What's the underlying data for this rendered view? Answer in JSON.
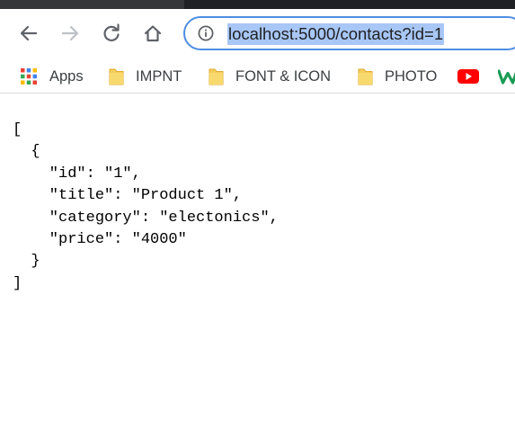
{
  "browser": {
    "address_bar": {
      "url": "localhost:5000/contacts?id=1",
      "selected": true
    },
    "icons": {
      "back": "back-arrow-icon",
      "forward": "forward-arrow-icon",
      "reload": "reload-icon",
      "home": "home-icon",
      "site_info": "info-circle-icon"
    },
    "bookmarks": [
      {
        "label": "Apps",
        "icon": "apps-grid-icon"
      },
      {
        "label": "IMPNT",
        "icon": "folder-icon"
      },
      {
        "label": "FONT & ICON",
        "icon": "folder-icon"
      },
      {
        "label": "PHOTO",
        "icon": "folder-icon"
      },
      {
        "label": "",
        "icon": "youtube-icon"
      },
      {
        "label": "",
        "icon": "w-logo-icon"
      }
    ]
  },
  "page": {
    "json_text": "[\n  {\n    \"id\": \"1\",\n    \"title\": \"Product 1\",\n    \"category\": \"electonics\",\n    \"price\": \"4000\"\n  }\n]"
  },
  "colors": {
    "accent": "#4f8ee3",
    "selection": "#a8c7f6",
    "folder": "#f5cd5a",
    "youtube": "#ff0000"
  }
}
